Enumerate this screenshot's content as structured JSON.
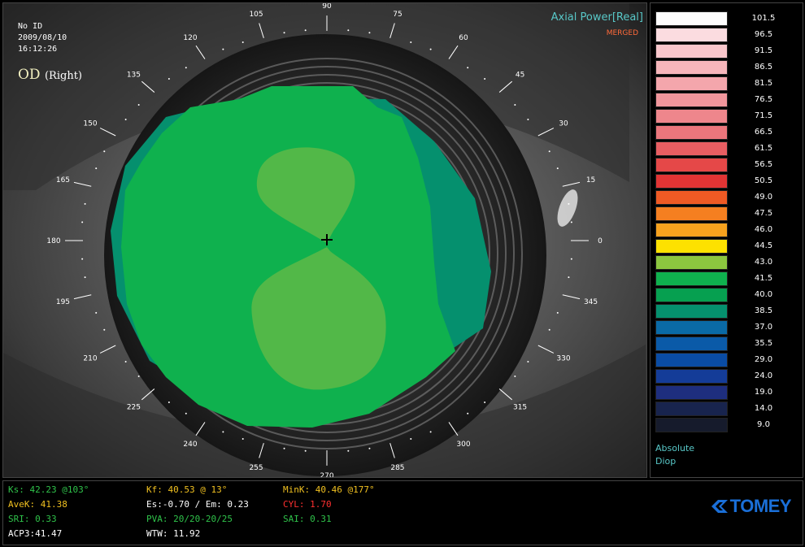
{
  "patient": {
    "id": "No ID",
    "date": "2009/08/10",
    "time": "16:12:26"
  },
  "eye": {
    "code": "OD",
    "side": "(Right)"
  },
  "map": {
    "title": "Axial Power[Real]",
    "mode": "MERGED"
  },
  "degree_labels": [
    "0",
    "15",
    "30",
    "45",
    "60",
    "75",
    "90",
    "105",
    "120",
    "135",
    "150",
    "165",
    "180",
    "195",
    "210",
    "225",
    "240",
    "255",
    "270",
    "285",
    "300",
    "315",
    "330",
    "345"
  ],
  "scale": {
    "entries": [
      {
        "value": "101.5",
        "color": "#fdfdfd"
      },
      {
        "value": "96.5",
        "color": "#fbdce0"
      },
      {
        "value": "91.5",
        "color": "#f9c7cc"
      },
      {
        "value": "86.5",
        "color": "#f6b6bb"
      },
      {
        "value": "81.5",
        "color": "#f4a6ac"
      },
      {
        "value": "76.5",
        "color": "#f1969c"
      },
      {
        "value": "71.5",
        "color": "#ee868c"
      },
      {
        "value": "66.5",
        "color": "#eb767c"
      },
      {
        "value": "61.5",
        "color": "#e85e62"
      },
      {
        "value": "56.5",
        "color": "#e54848"
      },
      {
        "value": "50.5",
        "color": "#e23434"
      },
      {
        "value": "49.0",
        "color": "#ef5a24"
      },
      {
        "value": "47.5",
        "color": "#f57f20"
      },
      {
        "value": "46.0",
        "color": "#f7a21e"
      },
      {
        "value": "44.5",
        "color": "#fde100"
      },
      {
        "value": "43.0",
        "color": "#8cc63f"
      },
      {
        "value": "41.5",
        "color": "#0fb14e"
      },
      {
        "value": "40.0",
        "color": "#06a050"
      },
      {
        "value": "38.5",
        "color": "#05906e"
      },
      {
        "value": "37.0",
        "color": "#0a6aa6"
      },
      {
        "value": "35.5",
        "color": "#0a5aa8"
      },
      {
        "value": "29.0",
        "color": "#0a4ca4"
      },
      {
        "value": "24.0",
        "color": "#143c98"
      },
      {
        "value": "19.0",
        "color": "#1e2e7e"
      },
      {
        "value": "14.0",
        "color": "#18244e"
      },
      {
        "value": "9.0",
        "color": "#161b2c"
      }
    ],
    "unit_line1": "Absolute",
    "unit_line2": "Diop"
  },
  "metrics": {
    "ks": "Ks: 42.23 @103°",
    "avek": "AveK: 41.38",
    "sri": "SRI: 0.33",
    "acp": "ACP3:41.47",
    "kf": "Kf: 40.53 @ 13°",
    "es_em": "Es:-0.70 / Em: 0.23",
    "pva": "PVA: 20/20-20/25",
    "wtw": "WTW: 11.92",
    "mink": "MinK: 40.46 @177°",
    "cyl": "CYL: 1.70",
    "sai": "SAI: 0.31"
  },
  "brand": "TOMEY",
  "colors": {
    "ks": "#2fc24a",
    "avek": "#f0c020",
    "kf": "#f0c020",
    "mink": "#f0c020",
    "cyl": "#ff3030",
    "brand": "#1a6fd8"
  }
}
